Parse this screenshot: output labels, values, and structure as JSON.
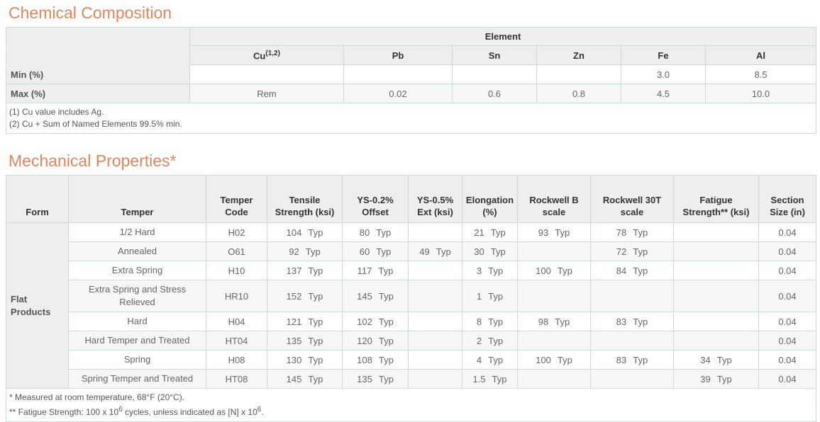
{
  "chemical": {
    "title": "Chemical Composition",
    "group_header": "Element",
    "element_symbol_cu": "Cu",
    "element_cu_sup": "(1,2)",
    "elements_rest": [
      "Pb",
      "Sn",
      "Zn",
      "Fe",
      "Al"
    ],
    "rows": [
      {
        "label": "Min (%)",
        "values": [
          "",
          "",
          "",
          "",
          "3.0",
          "8.5"
        ]
      },
      {
        "label": "Max (%)",
        "values": [
          "Rem",
          "0.02",
          "0.6",
          "0.8",
          "4.5",
          "10.0"
        ]
      }
    ],
    "notes": [
      "(1) Cu value includes Ag.",
      "(2) Cu + Sum of Named Elements 99.5% min."
    ]
  },
  "mechanical": {
    "title": "Mechanical Properties*",
    "headers": {
      "form": "Form",
      "temper": "Temper",
      "temper_code": "Temper Code",
      "tensile": "Tensile Strength (ksi)",
      "ys02": "YS-0.2% Offset",
      "ys05": "YS-0.5% Ext (ksi)",
      "elongation": "Elongation (%)",
      "rockwell_b": "Rockwell B scale",
      "rockwell_30t": "Rockwell 30T scale",
      "fatigue": "Fatigue Strength** (ksi)",
      "section": "Section Size (in)"
    },
    "form_label": "Flat Products",
    "typ_label": "Typ",
    "rows": [
      {
        "temper": "1/2 Hard",
        "code": "H02",
        "tensile": "104",
        "ys02": "80",
        "ys05": "",
        "elong": "21",
        "rb": "93",
        "r30t": "78",
        "fatigue": "",
        "size": "0.04"
      },
      {
        "temper": "Annealed",
        "code": "O61",
        "tensile": "92",
        "ys02": "60",
        "ys05": "49",
        "elong": "30",
        "rb": "",
        "r30t": "72",
        "fatigue": "",
        "size": "0.04"
      },
      {
        "temper": "Extra Spring",
        "code": "H10",
        "tensile": "137",
        "ys02": "117",
        "ys05": "",
        "elong": "3",
        "rb": "100",
        "r30t": "84",
        "fatigue": "",
        "size": "0.04"
      },
      {
        "temper": "Extra Spring and Stress Relieved",
        "code": "HR10",
        "tensile": "152",
        "ys02": "145",
        "ys05": "",
        "elong": "1",
        "rb": "",
        "r30t": "",
        "fatigue": "",
        "size": "0.04"
      },
      {
        "temper": "Hard",
        "code": "H04",
        "tensile": "121",
        "ys02": "102",
        "ys05": "",
        "elong": "8",
        "rb": "98",
        "r30t": "83",
        "fatigue": "",
        "size": "0.04"
      },
      {
        "temper": "Hard Temper and Treated",
        "code": "HT04",
        "tensile": "135",
        "ys02": "120",
        "ys05": "",
        "elong": "2",
        "rb": "",
        "r30t": "",
        "fatigue": "",
        "size": "0.04"
      },
      {
        "temper": "Spring",
        "code": "H08",
        "tensile": "130",
        "ys02": "108",
        "ys05": "",
        "elong": "4",
        "rb": "100",
        "r30t": "83",
        "fatigue": "34",
        "size": "0.04"
      },
      {
        "temper": "Spring Temper and Treated",
        "code": "HT08",
        "tensile": "145",
        "ys02": "135",
        "ys05": "",
        "elong": "1.5",
        "rb": "",
        "r30t": "",
        "fatigue": "39",
        "size": "0.04"
      }
    ],
    "note1": "* Measured at room temperature, 68°F (20°C).",
    "note2_pre": "** Fatigue Strength: 100 x 10",
    "note2_sup1": "6",
    "note2_mid": " cycles, unless indicated as [N] x 10",
    "note2_sup2": "6",
    "note2_post": "."
  }
}
